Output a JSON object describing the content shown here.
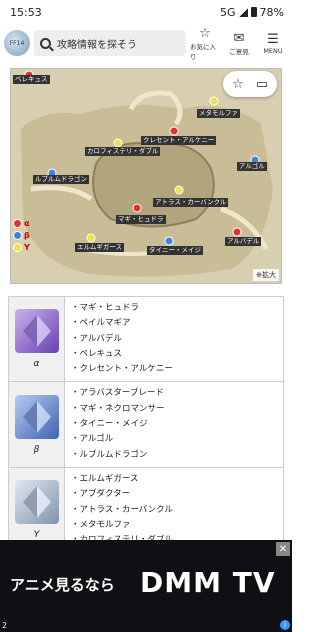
{
  "status": {
    "time": "15:53",
    "network": "5G",
    "battery": "78%"
  },
  "header": {
    "logo_label": "FF14",
    "search_placeholder": "攻略情報を探そう",
    "buttons": [
      {
        "name": "favorite",
        "icon": "star-icon",
        "label": "お気に入り"
      },
      {
        "name": "feedback",
        "icon": "mail-icon",
        "label": "ご意見"
      },
      {
        "name": "menu",
        "icon": "menu-icon",
        "label": "MENU"
      }
    ]
  },
  "map": {
    "markers": [
      {
        "label": "ベレキュス",
        "color": "#e03030"
      },
      {
        "label": "メタモルファ",
        "color": "#f0e050"
      },
      {
        "label": "クレセント・アルケニー",
        "color": "#e03030"
      },
      {
        "label": "カロフィステリ・ダブル",
        "color": "#f0e050"
      },
      {
        "label": "ルブルムドラゴン",
        "color": "#4080e0"
      },
      {
        "label": "アルゴル",
        "color": "#4080e0"
      },
      {
        "label": "アトラス・カーバンクル",
        "color": "#f0e050"
      },
      {
        "label": "マギ・ヒュドラ",
        "color": "#e03030"
      },
      {
        "label": "エルムギガース",
        "color": "#f0e050"
      },
      {
        "label": "タイニー・メイジ",
        "color": "#4080e0"
      },
      {
        "label": "アルバデル",
        "color": "#e03030"
      }
    ],
    "legend": [
      {
        "symbol": "α",
        "color": "#e03030"
      },
      {
        "symbol": "β",
        "color": "#4080e0"
      },
      {
        "symbol": "Y",
        "color": "#f0e050"
      }
    ],
    "zoom_label": "拡大"
  },
  "crystals": [
    {
      "symbol": "α",
      "color_a": "#6a3fb0",
      "color_b": "#c9b3f0",
      "items": [
        "・マギ・ヒュドラ",
        "・ペイルマギア",
        "・アルバデル",
        "・ベレキュス",
        "・クレセント・アルケニー"
      ]
    },
    {
      "symbol": "β",
      "color_a": "#3f63b0",
      "color_b": "#b7cbf2",
      "items": [
        "・アラバスターブレード",
        "・マギ・ネクロマンサー",
        "・タイニー・メイジ",
        "・アルゴル",
        "・ルブルムドラゴン"
      ]
    },
    {
      "symbol": "Y",
      "color_a": "#7f93ad",
      "color_b": "#e0e8f2",
      "items": [
        "・エルムギガース",
        "・アブダクター",
        "・アトラス・カーバンクル",
        "・メタモルファ",
        "・カロフィステリ・ダブル"
      ]
    }
  ],
  "ad": {
    "text": "アニメ見るなら",
    "brand": "DMM TV",
    "close": "✕",
    "info": "i",
    "page_num": "2"
  }
}
